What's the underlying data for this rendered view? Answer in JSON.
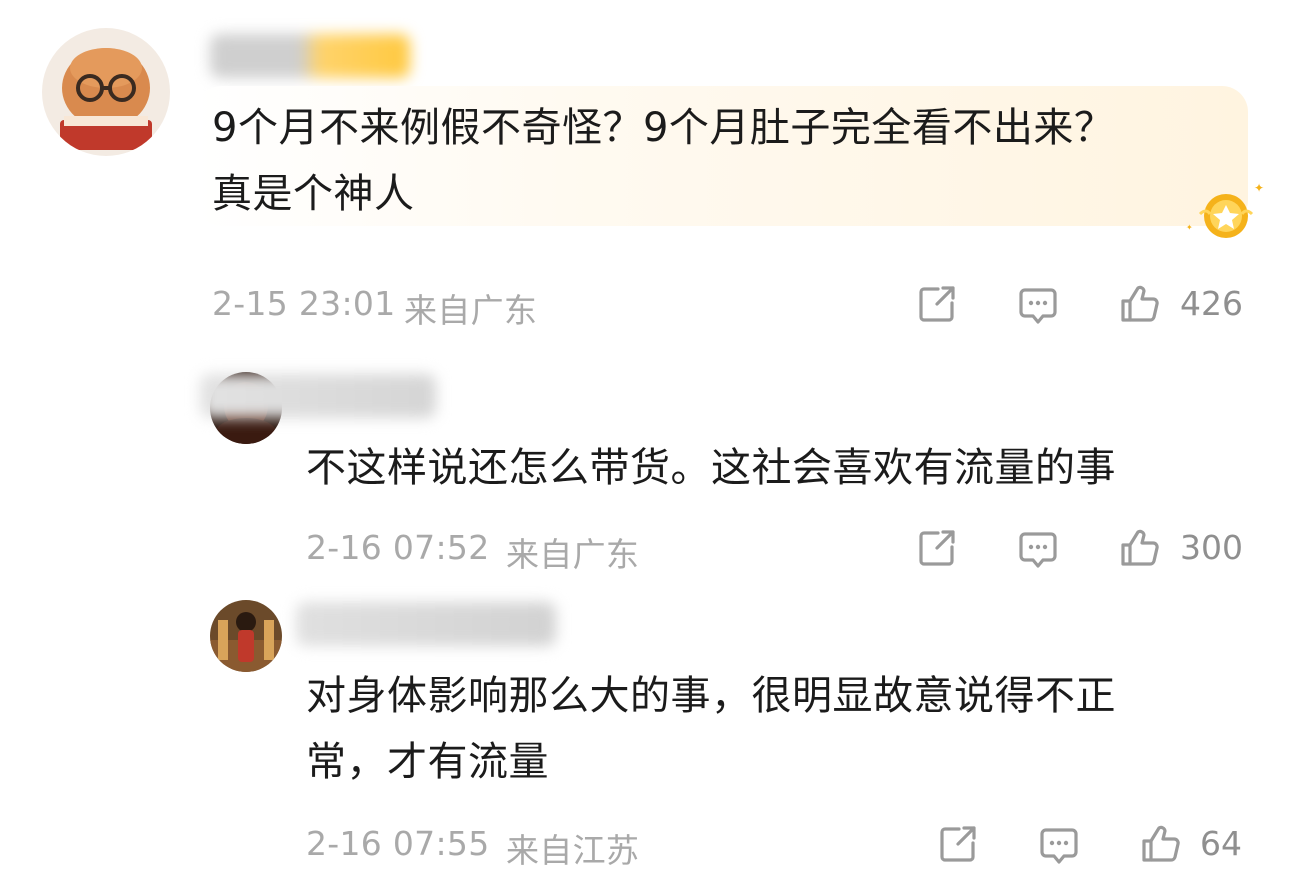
{
  "comments": [
    {
      "text_lines": [
        "9个月不来例假不奇怪？9个月肚子完全看不出来？",
        "真是个神人"
      ],
      "time": "2-15 23:01",
      "location": "来自广东",
      "likes": "426"
    },
    {
      "text_lines": [
        "不这样说还怎么带货。这社会喜欢有流量的事"
      ],
      "time": "2-16 07:52",
      "location": "来自广东",
      "likes": "300"
    },
    {
      "text_lines": [
        "对身体影响那么大的事，很明显故意说得不正",
        "常，才有流量"
      ],
      "time": "2-16 07:55",
      "location": "来自江苏",
      "likes": "64"
    }
  ],
  "icons": {
    "share": "share-icon",
    "reply": "comment-icon",
    "like": "thumbs-up-icon",
    "badge": "star-badge-icon"
  },
  "colors": {
    "bubble": "#fff4e0",
    "meta": "#a9a9a9",
    "text": "#1b1b1b",
    "badge": "#f5b21a"
  }
}
